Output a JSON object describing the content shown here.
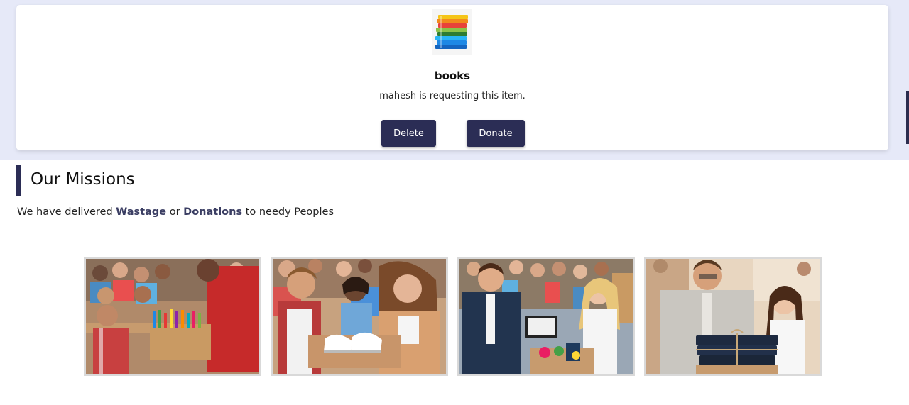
{
  "request_card": {
    "item_name": "books",
    "request_text": "mahesh is requesting this item.",
    "delete_label": "Delete",
    "donate_label": "Donate"
  },
  "missions": {
    "heading": "Our Missions",
    "sub_prefix": "We have delivered ",
    "sub_hl1": "Wastage",
    "sub_mid": " or ",
    "sub_hl2": "Donations",
    "sub_suffix": " to needy Peoples"
  },
  "colors": {
    "accent": "#2b2d55",
    "band": "#e6e9f8"
  }
}
